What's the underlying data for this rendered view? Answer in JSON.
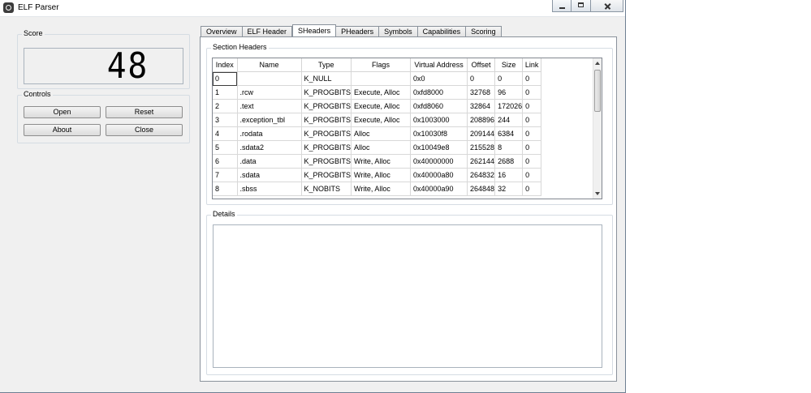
{
  "window": {
    "title": "ELF Parser"
  },
  "score": {
    "title": "Score",
    "value": "48"
  },
  "controls": {
    "title": "Controls",
    "open_label": "Open",
    "reset_label": "Reset",
    "about_label": "About",
    "close_label": "Close"
  },
  "tabs": [
    {
      "label": "Overview"
    },
    {
      "label": "ELF Header"
    },
    {
      "label": "SHeaders"
    },
    {
      "label": "PHeaders"
    },
    {
      "label": "Symbols"
    },
    {
      "label": "Capabilities"
    },
    {
      "label": "Scoring"
    }
  ],
  "active_tab": "SHeaders",
  "section_headers": {
    "title": "Section Headers",
    "columns": [
      "Index",
      "Name",
      "Type",
      "Flags",
      "Virtual Address",
      "Offset",
      "Size",
      "Link"
    ],
    "rows": [
      [
        "0",
        "",
        "K_NULL",
        "",
        "0x0",
        "0",
        "0",
        "0"
      ],
      [
        "1",
        ".rcw",
        "K_PROGBITS",
        "Execute, Alloc",
        "0xfd8000",
        "32768",
        "96",
        "0"
      ],
      [
        "2",
        ".text",
        "K_PROGBITS",
        "Execute, Alloc",
        "0xfd8060",
        "32864",
        "172026",
        "0"
      ],
      [
        "3",
        ".exception_tbl",
        "K_PROGBITS",
        "Execute, Alloc",
        "0x1003000",
        "208896",
        "244",
        "0"
      ],
      [
        "4",
        ".rodata",
        "K_PROGBITS",
        "Alloc",
        "0x10030f8",
        "209144",
        "6384",
        "0"
      ],
      [
        "5",
        ".sdata2",
        "K_PROGBITS",
        "Alloc",
        "0x10049e8",
        "215528",
        "8",
        "0"
      ],
      [
        "6",
        ".data",
        "K_PROGBITS",
        "Write, Alloc",
        "0x40000000",
        "262144",
        "2688",
        "0"
      ],
      [
        "7",
        ".sdata",
        "K_PROGBITS",
        "Write, Alloc",
        "0x40000a80",
        "264832",
        "16",
        "0"
      ],
      [
        "8",
        ".sbss",
        "K_NOBITS",
        "Write, Alloc",
        "0x40000a90",
        "264848",
        "32",
        "0"
      ]
    ]
  },
  "details": {
    "title": "Details",
    "text": ""
  }
}
